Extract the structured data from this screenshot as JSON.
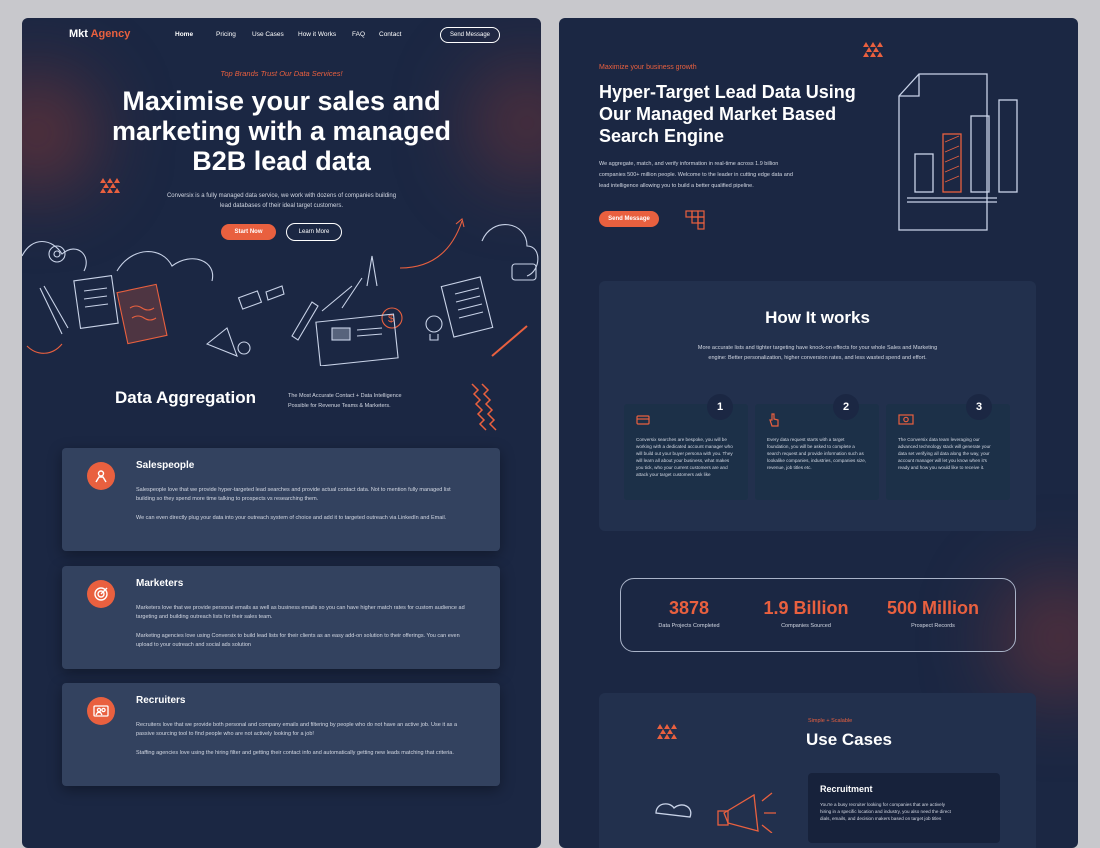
{
  "left": {
    "logo": {
      "part1": "Mkt",
      "part2": "Agency"
    },
    "nav": [
      "Home",
      "Pricing",
      "Use Cases",
      "How it Works",
      "FAQ",
      "Contact"
    ],
    "send_button": "Send Message",
    "hero": {
      "eyebrow": "Top Brands Trust Our Data Services!",
      "title_l1": "Maximise your sales and",
      "title_l2": "marketing with a managed",
      "title_l3": "B2B lead data",
      "desc_l1": "Conversix is a fully managed data service, we work with dozens of companies building",
      "desc_l2": "lead databases of their ideal target customers.",
      "start_button": "Start Now",
      "learn_button": "Learn More"
    },
    "aggregation": {
      "title": "Data Aggregation",
      "desc_l1": "The Most Accurate Contact + Data Intelligence",
      "desc_l2": "Possible for Revenue Teams & Marketers."
    },
    "cards": [
      {
        "title": "Salespeople",
        "p1": "Salespeople love that we provide hyper-targeted lead searches and provide actual contact data. Not to mention fully managed list building so they spend more time talking to prospects vs researching them.",
        "p2": "We can even directly plug your data into your outreach system of choice and add it to targeted outreach via LinkedIn and Email."
      },
      {
        "title": "Marketers",
        "p1": "Marketers love that we provide personal emails as well as business emails so you can have higher match rates for custom audience ad targeting and building outreach lists for their sales team.",
        "p2": "Marketing agencies love using Conversix to build lead lists for their clients as an easy add-on solution to their offerings. You can even upload to your outreach and social ads solution"
      },
      {
        "title": "Recruiters",
        "p1": "Recruiters love that we provide both personal and company emails and filtering by people who do not have an active job. Use it as a passive sourcing tool to find people who are not actively looking for a job!",
        "p2": "Staffing agencies love using the hiring filter and getting their contact info and automatically getting new leads matching that criteria."
      }
    ]
  },
  "right": {
    "eyebrow": "Maximize your business growth",
    "title_l1": "Hyper-Target Lead Data Using",
    "title_l2": "Our Managed Market Based",
    "title_l3": "Search Engine",
    "desc_l1": "We aggregate, match, and verify information in real-time across 1.9 billion",
    "desc_l2": "companies 500+ million people. Welcome to the leader in cutting edge data and",
    "desc_l3": "lead intelligence allowing you to build a better qualified pipeline.",
    "send_button": "Send Message",
    "how": {
      "title": "How It works",
      "desc_l1": "More accurate lists and tighter targeting have knock-on effects for your whole Sales and Marketing",
      "desc_l2": "engine: Better personalization, higher conversion rates, and less wasted spend and effort.",
      "steps": [
        {
          "num": "1",
          "text": "Conversix searches are bespoke, you will be working with a dedicated account manager who will build out your buyer persona with you. They will learn all about your business, what makes you tick, who your current customers are and attack your target customers ask like"
        },
        {
          "num": "2",
          "text": "Every data request starts with a target foundation, you will be asked to complete a search request and provide information such as lookalike companies, industries, companies size, revenue, job titles etc."
        },
        {
          "num": "3",
          "text": "The Conversix data team leveraging our advanced technology stack will generate your data set verifying all data along the way, your account manager will let you know when it's ready and how you would like to receive it."
        }
      ]
    },
    "stats": [
      {
        "value": "3878",
        "label": "Data Projects Completed"
      },
      {
        "value": "1.9 Billion",
        "label": "Companies Sourced"
      },
      {
        "value": "500 Million",
        "label": "Prospect Records"
      }
    ],
    "use_cases": {
      "eyebrow": "Simple + Scalable",
      "title": "Use Cases",
      "card_title": "Recruitment",
      "card_text_l1": "You're a busy recruiter looking for companies that are actively",
      "card_text_l2": "hiring in a specific location and industry, you also need the direct",
      "card_text_l3": "dials, emails, and decision makers based on target job titles"
    }
  },
  "colors": {
    "background": "#1b2743",
    "accent": "#e9603f",
    "card": "#33425f"
  }
}
